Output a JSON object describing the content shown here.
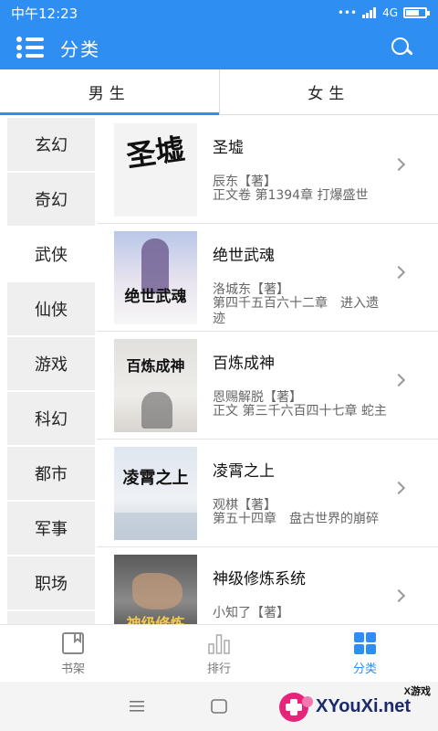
{
  "status": {
    "time": "中午12:23",
    "network": "4G"
  },
  "header": {
    "title": "分类"
  },
  "tabs": [
    {
      "label": "男生"
    },
    {
      "label": "女生"
    }
  ],
  "categories": [
    {
      "label": "玄幻"
    },
    {
      "label": "奇幻"
    },
    {
      "label": "武侠"
    },
    {
      "label": "仙侠"
    },
    {
      "label": "游戏"
    },
    {
      "label": "科幻"
    },
    {
      "label": "都市"
    },
    {
      "label": "军事"
    },
    {
      "label": "职场"
    }
  ],
  "books": [
    {
      "title": "圣墟",
      "author": "辰东【著】",
      "chapter": "正文卷 第1394章 打爆盛世",
      "cover_text": "圣墟"
    },
    {
      "title": "绝世武魂",
      "author": "洛城东【著】",
      "chapter": "第四千五百六十二章　进入遗迹",
      "cover_text": "绝世武魂"
    },
    {
      "title": "百炼成神",
      "author": "恩赐解脱【著】",
      "chapter": "正文 第三千六百四十七章 蛇主",
      "cover_text": "百炼成神"
    },
    {
      "title": "凌霄之上",
      "author": "观棋【著】",
      "chapter": "第五十四章　盘古世界的崩碎",
      "cover_text": "凌霄之上"
    },
    {
      "title": "神级修炼系统",
      "author": "小知了【著】",
      "chapter": "",
      "cover_text": "神级修炼"
    }
  ],
  "bottom_nav": [
    {
      "label": "书架"
    },
    {
      "label": "排行"
    },
    {
      "label": "分类"
    }
  ],
  "watermark": {
    "brand": "XYouXi.net",
    "tag": "X游戏"
  },
  "colors": {
    "primary": "#2f8ef2"
  }
}
